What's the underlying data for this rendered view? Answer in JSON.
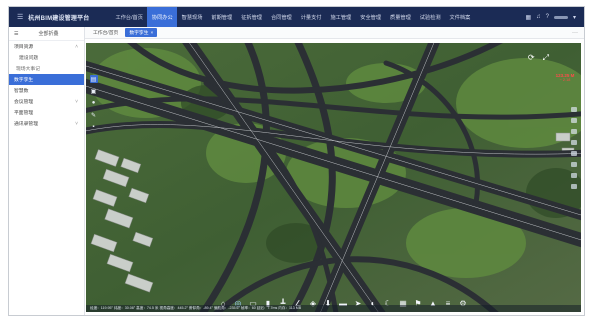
{
  "app": {
    "title": "杭州BIM建设管理平台",
    "menu_icon": "menu-icon"
  },
  "nav": {
    "items": [
      {
        "label": "工作台/首页",
        "active": false
      },
      {
        "label": "协同办公",
        "active": true
      },
      {
        "label": "智慧现场",
        "active": false
      },
      {
        "label": "前期管理",
        "active": false
      },
      {
        "label": "征拆管理",
        "active": false
      },
      {
        "label": "合同管理",
        "active": false
      },
      {
        "label": "计量支付",
        "active": false
      },
      {
        "label": "施工管理",
        "active": false
      },
      {
        "label": "安全管理",
        "active": false
      },
      {
        "label": "质量管理",
        "active": false
      },
      {
        "label": "试验检测",
        "active": false
      },
      {
        "label": "文件档案",
        "active": false
      }
    ],
    "right_icons": [
      "grid-icon",
      "bell-icon",
      "help-icon"
    ]
  },
  "sidebar": {
    "collapse_label": "全部折叠",
    "items": [
      {
        "label": "项目资源",
        "level": 0,
        "chevron": "˄",
        "active": false
      },
      {
        "label": "建设问题",
        "level": 2,
        "chevron": "",
        "active": false
      },
      {
        "label": "现场大事记",
        "level": 1,
        "chevron": "",
        "active": false
      },
      {
        "label": "数字孪生",
        "level": 0,
        "chevron": "",
        "active": true
      },
      {
        "label": "智慧数",
        "level": 0,
        "chevron": "",
        "active": false
      },
      {
        "label": "会议管理",
        "level": 0,
        "chevron": "˅",
        "active": false
      },
      {
        "label": "平面管理",
        "level": 0,
        "chevron": "",
        "active": false
      },
      {
        "label": "通讯录管理",
        "level": 0,
        "chevron": "˅",
        "active": false
      }
    ]
  },
  "tabs": {
    "items": [
      {
        "label": "工作台/首页",
        "active": false
      },
      {
        "label": "数字孪生",
        "active": true,
        "close": "×"
      }
    ],
    "more": "···"
  },
  "viewport": {
    "compass_value": "123.25 M",
    "compass_sub": "~ 2.18",
    "left_tools": [
      "layers-icon",
      "folder-icon",
      "chat-icon",
      "edit-icon",
      "delete-icon"
    ],
    "bottom_tools": [
      "home-icon",
      "globe-icon",
      "ruler-icon",
      "split-icon",
      "height-icon",
      "angle-icon",
      "cube-icon",
      "download-icon",
      "video-icon",
      "send-icon",
      "contrast-icon",
      "moon-icon",
      "box-icon",
      "flag-icon",
      "pin-icon",
      "list-icon",
      "settings-icon"
    ],
    "status_text": "经度：119.95°  纬度：30.08°  高度：74.5 米  视角高度：445.2°  俯仰角：-89.4°  偏航角：-235.6°  帧率：60  延迟：7.7ms  内存：113 MB"
  },
  "colors": {
    "topbar": "#1b2b55",
    "accent": "#3a6ed8",
    "compass_text": "#ff4a4a"
  }
}
